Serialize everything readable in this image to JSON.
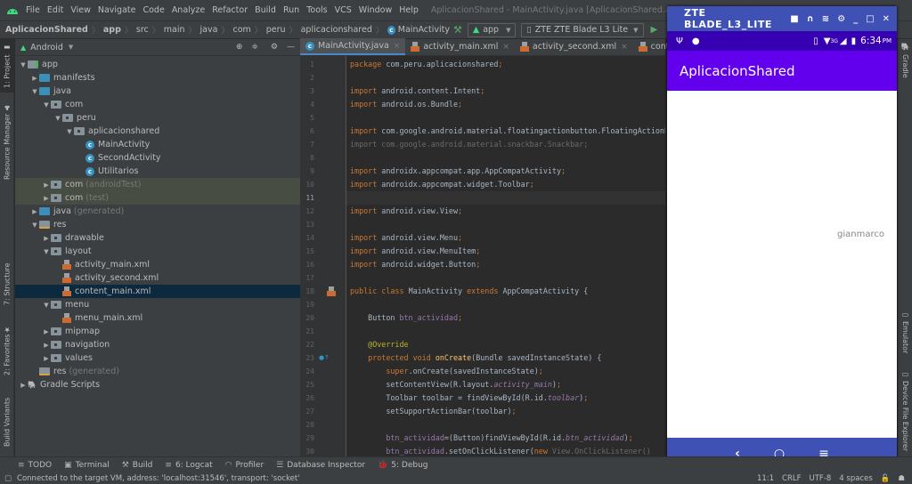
{
  "menubar": {
    "items": [
      "File",
      "Edit",
      "View",
      "Navigate",
      "Code",
      "Analyze",
      "Refactor",
      "Build",
      "Run",
      "Tools",
      "VCS",
      "Window",
      "Help"
    ],
    "window_title": "AplicacionShared - MainActivity.java [AplicacionShared.app] - Android Studio"
  },
  "breadcrumb": {
    "items": [
      "AplicacionShared",
      "app",
      "src",
      "main",
      "java",
      "com",
      "peru",
      "aplicacionshared",
      "MainActivity"
    ]
  },
  "toolbar": {
    "config": "app",
    "device": "ZTE ZTE Blade L3 Lite"
  },
  "left_strip": {
    "project": "1: Project",
    "resource_manager": "Resource Manager",
    "structure": "7: Structure",
    "favorites": "2: Favorites",
    "build_variants": "Build Variants"
  },
  "right_strip": {
    "gradle": "Gradle",
    "emulator": "Emulator",
    "device_file_explorer": "Device File Explorer"
  },
  "project": {
    "view": "Android",
    "tree": [
      {
        "label": "app",
        "suffix": "",
        "depth": 0,
        "arrow": "down",
        "icon": "module"
      },
      {
        "label": "manifests",
        "suffix": "",
        "depth": 1,
        "arrow": "right",
        "icon": "folder-blue"
      },
      {
        "label": "java",
        "suffix": "",
        "depth": 1,
        "arrow": "down",
        "icon": "folder-blue"
      },
      {
        "label": "com",
        "suffix": "",
        "depth": 2,
        "arrow": "down",
        "icon": "package"
      },
      {
        "label": "peru",
        "suffix": "",
        "depth": 3,
        "arrow": "down",
        "icon": "package"
      },
      {
        "label": "aplicacionshared",
        "suffix": "",
        "depth": 4,
        "arrow": "down",
        "icon": "package"
      },
      {
        "label": "MainActivity",
        "suffix": "",
        "depth": 5,
        "arrow": "",
        "icon": "class"
      },
      {
        "label": "SecondActivity",
        "suffix": "",
        "depth": 5,
        "arrow": "",
        "icon": "class"
      },
      {
        "label": "Utilitarios",
        "suffix": "",
        "depth": 5,
        "arrow": "",
        "icon": "class"
      },
      {
        "label": "com",
        "suffix": "(androidTest)",
        "depth": 2,
        "arrow": "right",
        "icon": "package",
        "highlight": "green"
      },
      {
        "label": "com",
        "suffix": "(test)",
        "depth": 2,
        "arrow": "right",
        "icon": "package",
        "highlight": "green"
      },
      {
        "label": "java",
        "suffix": "(generated)",
        "depth": 1,
        "arrow": "right",
        "icon": "folder-blue"
      },
      {
        "label": "res",
        "suffix": "",
        "depth": 1,
        "arrow": "down",
        "icon": "res"
      },
      {
        "label": "drawable",
        "suffix": "",
        "depth": 2,
        "arrow": "right",
        "icon": "package"
      },
      {
        "label": "layout",
        "suffix": "",
        "depth": 2,
        "arrow": "down",
        "icon": "package"
      },
      {
        "label": "activity_main.xml",
        "suffix": "",
        "depth": 3,
        "arrow": "",
        "icon": "xml"
      },
      {
        "label": "activity_second.xml",
        "suffix": "",
        "depth": 3,
        "arrow": "",
        "icon": "xml"
      },
      {
        "label": "content_main.xml",
        "suffix": "",
        "depth": 3,
        "arrow": "",
        "icon": "xml",
        "highlight": "selected"
      },
      {
        "label": "menu",
        "suffix": "",
        "depth": 2,
        "arrow": "down",
        "icon": "package"
      },
      {
        "label": "menu_main.xml",
        "suffix": "",
        "depth": 3,
        "arrow": "",
        "icon": "xml"
      },
      {
        "label": "mipmap",
        "suffix": "",
        "depth": 2,
        "arrow": "right",
        "icon": "package"
      },
      {
        "label": "navigation",
        "suffix": "",
        "depth": 2,
        "arrow": "right",
        "icon": "package"
      },
      {
        "label": "values",
        "suffix": "",
        "depth": 2,
        "arrow": "right",
        "icon": "package"
      },
      {
        "label": "res",
        "suffix": "(generated)",
        "depth": 1,
        "arrow": "",
        "icon": "res"
      },
      {
        "label": "Gradle Scripts",
        "suffix": "",
        "depth": 0,
        "arrow": "right",
        "icon": "gradle"
      }
    ]
  },
  "editor": {
    "tabs": [
      {
        "label": "MainActivity.java",
        "icon": "class",
        "active": true
      },
      {
        "label": "activity_main.xml",
        "icon": "xml",
        "active": false
      },
      {
        "label": "activity_second.xml",
        "icon": "xml",
        "active": false
      },
      {
        "label": "content_main.xml",
        "icon": "xml",
        "active": false
      }
    ],
    "current_line": 11,
    "lines": [
      [
        [
          "kw",
          "package "
        ],
        [
          "t",
          "com.peru.aplicacionshared"
        ],
        [
          "kw",
          ";"
        ]
      ],
      [],
      [
        [
          "kw",
          "import "
        ],
        [
          "t",
          "android.content.Intent"
        ],
        [
          "kw",
          ";"
        ]
      ],
      [
        [
          "kw",
          "import "
        ],
        [
          "t",
          "android.os.Bundle"
        ],
        [
          "kw",
          ";"
        ]
      ],
      [],
      [
        [
          "kw",
          "import "
        ],
        [
          "t",
          "com.google.android.material.floatingactionbutton.FloatingActionButton"
        ],
        [
          "kw",
          ";"
        ]
      ],
      [
        [
          "grey",
          "import com.google.android.material.snackbar.Snackbar;"
        ]
      ],
      [],
      [
        [
          "kw",
          "import "
        ],
        [
          "t",
          "androidx.appcompat.app.AppCompatActivity"
        ],
        [
          "kw",
          ";"
        ]
      ],
      [
        [
          "kw",
          "import "
        ],
        [
          "t",
          "androidx.appcompat.widget.Toolbar"
        ],
        [
          "kw",
          ";"
        ]
      ],
      [],
      [
        [
          "kw",
          "import "
        ],
        [
          "t",
          "android.view.View"
        ],
        [
          "kw",
          ";"
        ]
      ],
      [],
      [
        [
          "kw",
          "import "
        ],
        [
          "t",
          "android.view.Menu"
        ],
        [
          "kw",
          ";"
        ]
      ],
      [
        [
          "kw",
          "import "
        ],
        [
          "t",
          "android.view.MenuItem"
        ],
        [
          "kw",
          ";"
        ]
      ],
      [
        [
          "kw",
          "import "
        ],
        [
          "t",
          "android.widget.Button"
        ],
        [
          "kw",
          ";"
        ]
      ],
      [],
      [
        [
          "kw",
          "public class "
        ],
        [
          "t",
          "MainActivity "
        ],
        [
          "kw",
          "extends "
        ],
        [
          "t",
          "AppCompatActivity {"
        ]
      ],
      [],
      [
        [
          "t",
          "    Button "
        ],
        [
          "var",
          "btn_actividad"
        ],
        [
          "kw",
          ";"
        ]
      ],
      [],
      [
        [
          "ann",
          "    @Override"
        ]
      ],
      [
        [
          "kw",
          "    protected void "
        ],
        [
          "fn",
          "onCreate"
        ],
        [
          "t",
          "(Bundle savedInstanceState) {"
        ]
      ],
      [
        [
          "kw",
          "        super"
        ],
        [
          "t",
          ".onCreate(savedInstanceState)"
        ],
        [
          "kw",
          ";"
        ]
      ],
      [
        [
          "t",
          "        setContentView(R.layout."
        ],
        [
          "fld",
          "activity_main"
        ],
        [
          "t",
          ")"
        ],
        [
          "kw",
          ";"
        ]
      ],
      [
        [
          "t",
          "        Toolbar toolbar = findViewById(R.id."
        ],
        [
          "fld",
          "toolbar"
        ],
        [
          "t",
          ")"
        ],
        [
          "kw",
          ";"
        ]
      ],
      [
        [
          "t",
          "        setSupportActionBar(toolbar)"
        ],
        [
          "kw",
          ";"
        ]
      ],
      [],
      [
        [
          "var",
          "        btn_actividad"
        ],
        [
          "t",
          "=(Button)findViewById(R.id."
        ],
        [
          "fld",
          "btn_actividad"
        ],
        [
          "t",
          ")"
        ],
        [
          "kw",
          ";"
        ]
      ],
      [
        [
          "var",
          "        btn_actividad"
        ],
        [
          "t",
          ".setOnClickListener("
        ],
        [
          "kw",
          "new "
        ],
        [
          "grey",
          "View.OnClickListener()"
        ]
      ]
    ]
  },
  "emulator": {
    "title": "ZTE BLADE_L3_LITE",
    "clock": "6:34",
    "clock_suffix": "PM",
    "network": "3G",
    "app_title": "AplicacionShared",
    "content_text": "gianmarco",
    "colors": {
      "frame": "#3f51b5",
      "status": "#3700b3",
      "appbar": "#6200ee"
    }
  },
  "bottom_tools": [
    {
      "label": "TODO",
      "icon": "≡"
    },
    {
      "label": "Terminal",
      "icon": "▣"
    },
    {
      "label": "Build",
      "icon": "⚒"
    },
    {
      "label": "6: Logcat",
      "icon": "≡"
    },
    {
      "label": "Profiler",
      "icon": "◠"
    },
    {
      "label": "Database Inspector",
      "icon": "☰"
    },
    {
      "label": "5: Debug",
      "icon": "🐞"
    }
  ],
  "status": {
    "message": "Connected to the target VM, address: 'localhost:31546', transport: 'socket'",
    "position": "11:1",
    "line_sep": "CRLF",
    "encoding": "UTF-8",
    "indent": "4 spaces"
  }
}
